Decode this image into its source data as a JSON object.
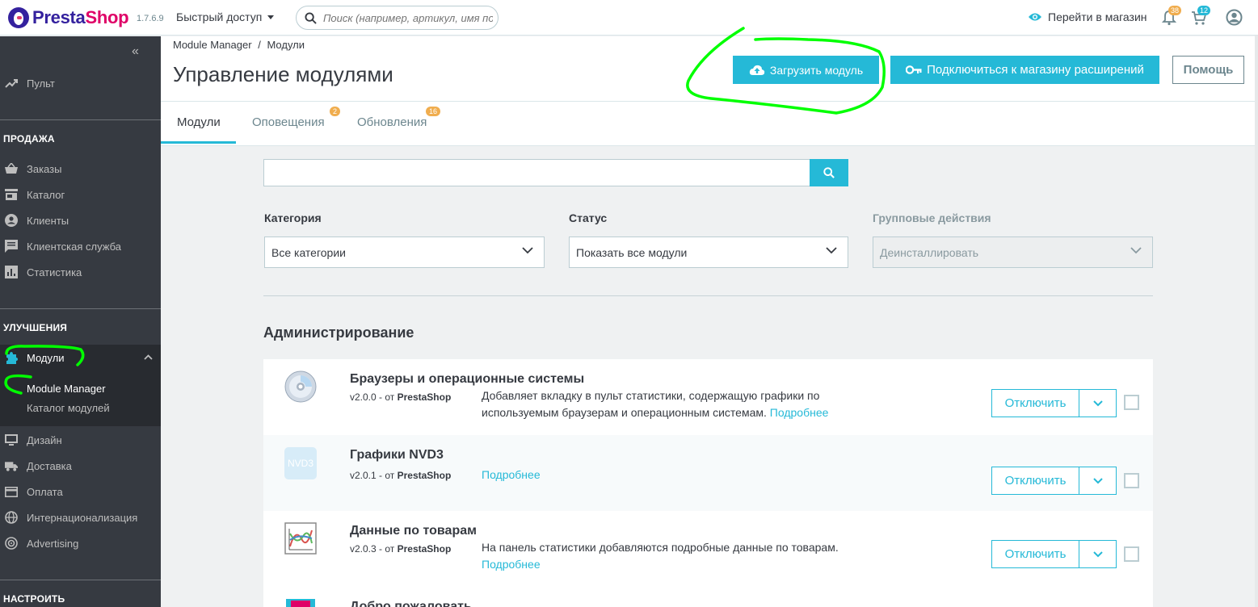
{
  "header": {
    "brand_part1": "Presta",
    "brand_part2": "Shop",
    "version": "1.7.6.9",
    "quick_access": "Быстрый доступ",
    "search_placeholder": "Поиск (например, артикул, имя поль:",
    "view_shop": "Перейти в магазин",
    "notif_orders_count": "38",
    "notif_customers_count": "12"
  },
  "sidebar": {
    "collapse_glyph": "«",
    "dashboard": "Пульт",
    "section_sell": "ПРОДАЖА",
    "sell_items": [
      "Заказы",
      "Каталог",
      "Клиенты",
      "Клиентская служба",
      "Статистика"
    ],
    "section_improve": "УЛУЧШЕНИЯ",
    "modules": "Модули",
    "module_manager": "Module Manager",
    "module_catalog": "Каталог модулей",
    "improve_items": [
      "Дизайн",
      "Доставка",
      "Оплата",
      "Интернационализация",
      "Advertising"
    ],
    "section_configure": "НАСТРОИТЬ"
  },
  "page": {
    "breadcrumb_1": "Module Manager",
    "breadcrumb_sep": "/",
    "breadcrumb_2": "Модули",
    "title": "Управление модулями",
    "btn_upload": "Загрузить модуль",
    "btn_connect": "Подключиться к магазину расширений",
    "btn_help": "Помощь",
    "tabs": [
      {
        "label": "Модули",
        "badge": ""
      },
      {
        "label": "Оповещения",
        "badge": "2"
      },
      {
        "label": "Обновления",
        "badge": "16"
      }
    ]
  },
  "filters": {
    "search_value": "",
    "category_label": "Категория",
    "category_value": "Все категории",
    "status_label": "Статус",
    "status_value": "Показать все модули",
    "bulk_label": "Групповые действия",
    "bulk_value": "Деинсталлировать"
  },
  "category_title": "Администрирование",
  "modules": [
    {
      "name": "Браузеры и операционные системы",
      "version": "v2.0.0 - от",
      "author": "PrestaShop",
      "desc": "Добавляет вкладку в пульт статистики, содержащую графики по используемым браузерам и операционным системам.",
      "more": "Подробнее",
      "action": "Отключить",
      "icon": "cd-disc-icon"
    },
    {
      "name": "Графики NVD3",
      "version": "v2.0.1 - от",
      "author": "PrestaShop",
      "desc": "",
      "more": "Подробнее",
      "action": "Отключить",
      "icon": "nvd3-icon",
      "icon_text": "NVD3"
    },
    {
      "name": "Данные по товарам",
      "version": "v2.0.3 - от",
      "author": "PrestaShop",
      "desc": "На панель статистики добавляются подробные данные по товарам.",
      "more": "Подробнее",
      "action": "Отключить",
      "icon": "chart-icon"
    },
    {
      "name": "Добро пожаловать",
      "icon": "welcome-icon"
    }
  ],
  "colors": {
    "primary": "#25b9d7",
    "sidebar": "#363a41",
    "annotation": "#00ff00"
  }
}
